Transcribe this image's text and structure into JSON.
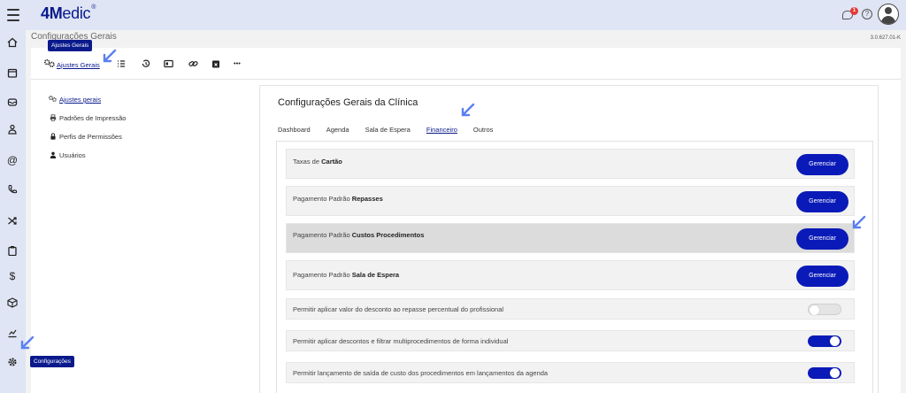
{
  "app": {
    "logo_bold": "4M",
    "logo_rest": "edic",
    "logo_reg": "®",
    "version": "3.0.627.01-K"
  },
  "header": {
    "notification_count": "1",
    "help_symbol": "?"
  },
  "page": {
    "title": "Configurações Gerais"
  },
  "tooltips": {
    "ajustes": "Ajustes Gerais",
    "configuracoes": "Configurações"
  },
  "toolbar": {
    "ajustes_label": "Ajustes Gerais",
    "more_label": "•••"
  },
  "settings_nav": [
    {
      "label": "Ajustes gerais",
      "icon": "gears-icon"
    },
    {
      "label": "Padrões de Impressão",
      "icon": "printer-icon"
    },
    {
      "label": "Perfis de Permissões",
      "icon": "lock-icon"
    },
    {
      "label": "Usuários",
      "icon": "user-icon"
    }
  ],
  "panel": {
    "title": "Configurações Gerais da Clínica",
    "tabs": [
      "Dashboard",
      "Agenda",
      "Sala de Espera",
      "Financeiro",
      "Outros"
    ],
    "active_tab": "Financeiro"
  },
  "rows": [
    {
      "prefix": "Taxas de ",
      "bold": "Cartão",
      "action": "Gerenciar"
    },
    {
      "prefix": "Pagamento Padrão ",
      "bold": "Repasses",
      "action": "Gerenciar"
    },
    {
      "prefix": "Pagamento Padrão ",
      "bold": "Custos Procedimentos",
      "action": "Gerenciar"
    },
    {
      "prefix": "Pagamento Padrão ",
      "bold": "Sala de Espera",
      "action": "Gerenciar"
    }
  ],
  "toggles": [
    {
      "label": "Permitir aplicar valor do desconto ao repasse percentual do profissional",
      "enabled": false
    },
    {
      "label": "Permitir aplicar descontos e filtrar multiprocedimentos de forma individual",
      "enabled": true
    },
    {
      "label": "Permitir lançamento de saída de custo dos procedimentos em lançamentos da agenda",
      "enabled": true
    }
  ],
  "colors": {
    "brand": "#0a1a8c",
    "button": "#0a1ab8",
    "arrow": "#5b7ff0",
    "badge": "#e53935"
  }
}
